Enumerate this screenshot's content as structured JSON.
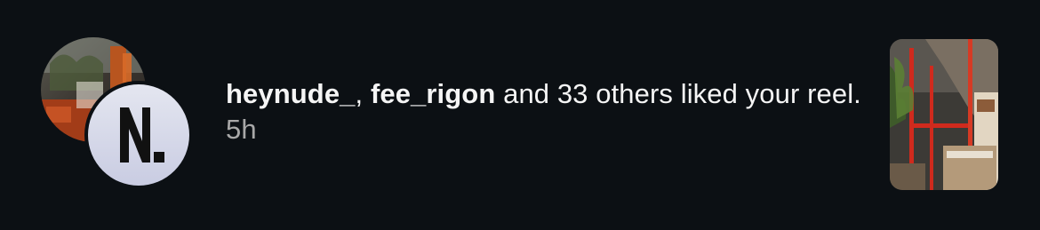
{
  "notification": {
    "user1": "heynude_",
    "separator": ", ",
    "user2": "fee_rigon",
    "action": " and 33 others liked your reel.",
    "gap": " ",
    "time": "5h"
  },
  "avatars": {
    "back_icon": "photo-avatar",
    "front_icon": "letter-n-logo"
  },
  "colors": {
    "background": "#0c1014",
    "text": "#f5f5f5",
    "timestamp": "#a8a8a8"
  }
}
